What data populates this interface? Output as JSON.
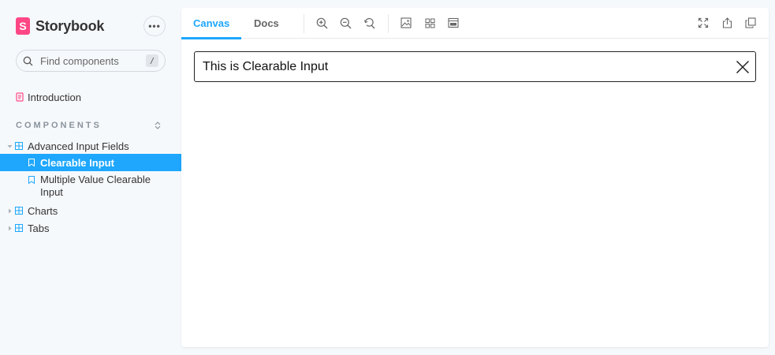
{
  "sidebar": {
    "brand": {
      "logo_letter": "S",
      "name": "Storybook"
    },
    "menu_label": "•••",
    "search": {
      "placeholder": "Find components",
      "shortcut": "/"
    },
    "intro": {
      "label": "Introduction"
    },
    "section_title": "COMPONENTS",
    "items": [
      {
        "label": "Advanced Input Fields"
      },
      {
        "label": "Clearable Input"
      },
      {
        "label_line1": "Multiple Value Clearable",
        "label_line2": "Input"
      },
      {
        "label": "Charts"
      },
      {
        "label": "Tabs"
      }
    ]
  },
  "toolbar": {
    "tabs": [
      {
        "label": "Canvas"
      },
      {
        "label": "Docs"
      }
    ],
    "icons": [
      "zoom-in-icon",
      "zoom-out-icon",
      "zoom-reset-icon",
      "background-icon",
      "grid-icon",
      "viewport-icon",
      "fullscreen-icon",
      "share-icon",
      "copy-link-icon"
    ]
  },
  "canvas": {
    "input_value": "This is Clearable Input"
  },
  "colors": {
    "accent": "#1ea7fd",
    "brand": "#ff4785",
    "sidebar_bg": "#f6f9fc"
  }
}
